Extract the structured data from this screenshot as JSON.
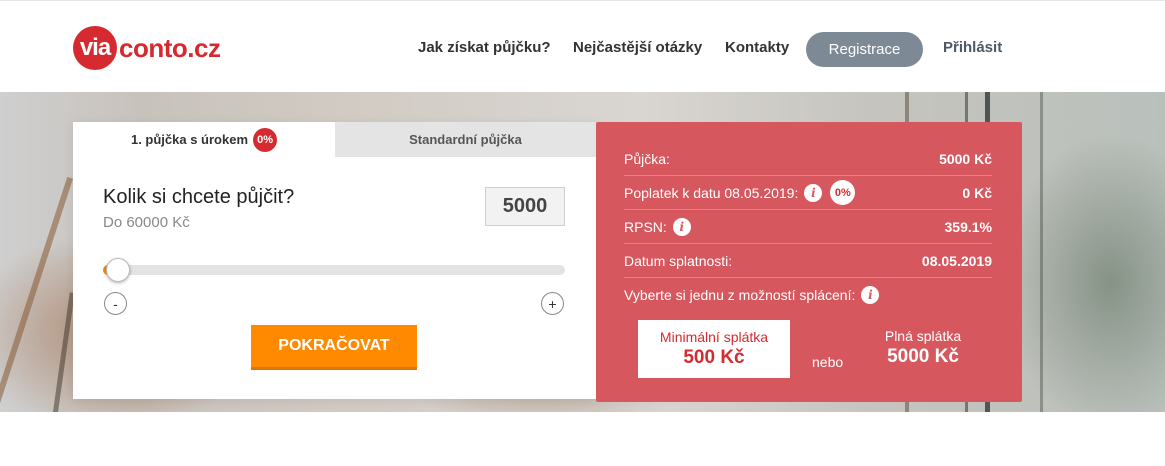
{
  "header": {
    "logo_mark": "via",
    "logo_text": "conto.cz",
    "nav": [
      "Jak získat půjčku?",
      "Nejčastější otázky",
      "Kontakty"
    ],
    "register_label": "Registrace",
    "login_label": "Přihlásit"
  },
  "calculator": {
    "tab_interest": "1. půjčka s úrokem",
    "tab_interest_badge": "0%",
    "tab_standard": "Standardní půjčka",
    "question": "Kolik si chcete půjčit?",
    "limit": "Do 60000 Kč",
    "amount_value": "5000",
    "slider_fraction": 0.034,
    "minus_label": "-",
    "plus_label": "+",
    "continue_label": "POKRAČOVAT",
    "accent_color": "#ff8a00"
  },
  "summary": {
    "rows": [
      {
        "label": "Půjčka:",
        "value": "5000 Kč"
      },
      {
        "label": "Poplatek k datu 08.05.2019:",
        "value": "0 Kč",
        "badge": "0%"
      },
      {
        "label": "RPSN:",
        "value": "359.1%"
      },
      {
        "label": "Datum splatnosti:",
        "value": "08.05.2019"
      }
    ],
    "choose_label": "Vyberte si jednu z možností splácení:",
    "min_title": "Minimální splátka",
    "min_value": "500 Kč",
    "or_label": "nebo",
    "full_title": "Plná splátka",
    "full_value": "5000 Kč",
    "panel_color": "#d6585e"
  }
}
